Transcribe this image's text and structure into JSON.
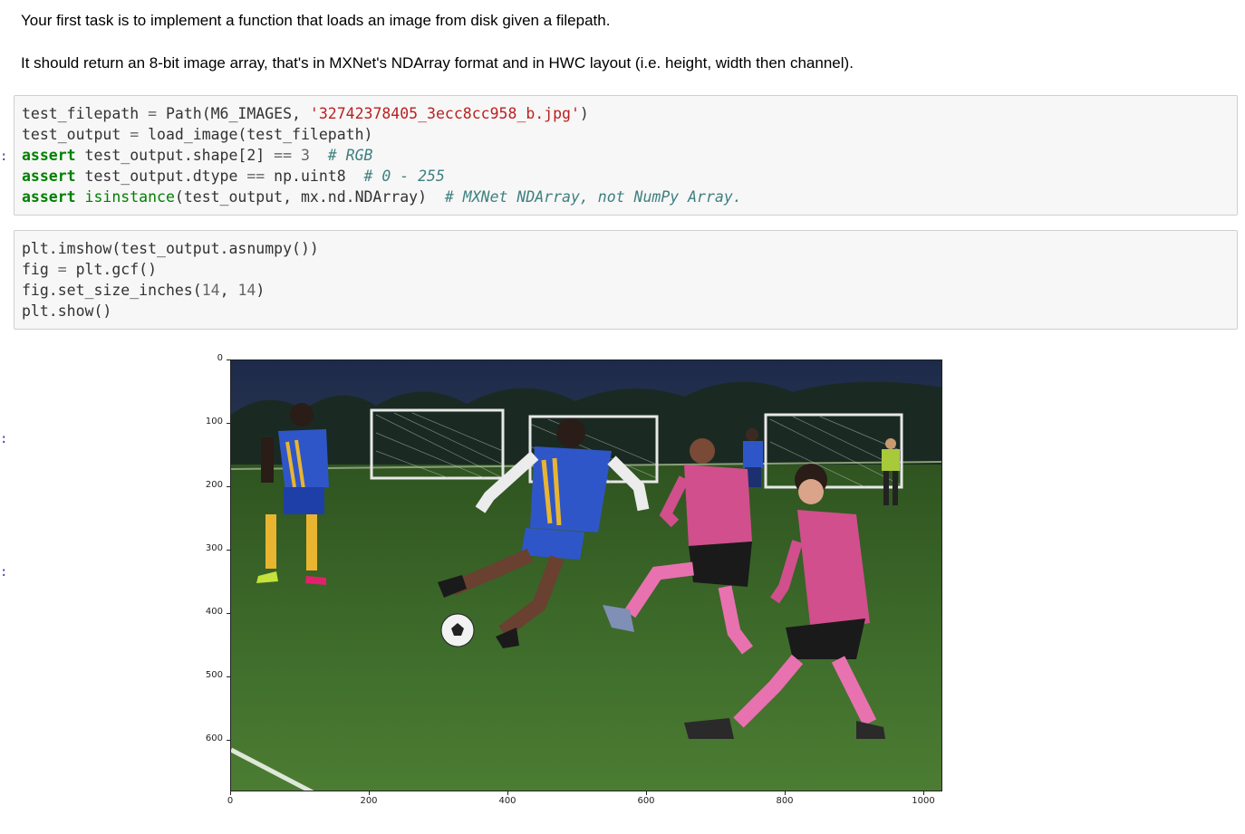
{
  "markdown": {
    "line1": "Your first task is to implement a function that loads an image from disk given a filepath.",
    "line2": "It should return an 8-bit image array, that's in MXNet's NDArray format and in HWC layout (i.e. height, width then channel)."
  },
  "cells": {
    "prompt_marker": ":",
    "cell1": {
      "l1_a": "test_filepath",
      "l1_op": " = ",
      "l1_b": "Path(M6_IMAGES, ",
      "l1_str": "'32742378405_3ecc8cc958_b.jpg'",
      "l1_c": ")",
      "l2_a": "test_output",
      "l2_op": " = ",
      "l2_b": "load_image(test_filepath)",
      "l3_kw": "assert",
      "l3_a": " test_output.shape[2] ",
      "l3_op": "==",
      "l3_num": " 3",
      "l3_cm": "  # RGB",
      "l4_kw": "assert",
      "l4_a": " test_output.dtype ",
      "l4_op": "==",
      "l4_b": " np.uint8",
      "l4_cm": "  # 0 - 255",
      "l5_kw": "assert",
      "l5_bi": " isinstance",
      "l5_a": "(test_output, mx.nd.NDArray)",
      "l5_cm": "  # MXNet NDArray, not NumPy Array."
    },
    "cell2": {
      "l1": "plt.imshow(test_output.asnumpy())",
      "l2_a": "fig",
      "l2_op": " = ",
      "l2_b": "plt.gcf()",
      "l3_a": "fig.set_size_inches(",
      "l3_n1": "14",
      "l3_b": ", ",
      "l3_n2": "14",
      "l3_c": ")",
      "l4": "plt.show()"
    }
  },
  "plot": {
    "y_ticks": [
      "0",
      "100",
      "200",
      "300",
      "400",
      "500",
      "600"
    ],
    "x_ticks": [
      "0",
      "200",
      "400",
      "600",
      "800",
      "1000"
    ],
    "colors": {
      "sky": "#1d2a4a",
      "turf": "#3d6a2a",
      "blue_kit": "#2f56c8",
      "pink_kit": "#d04f8c"
    }
  }
}
